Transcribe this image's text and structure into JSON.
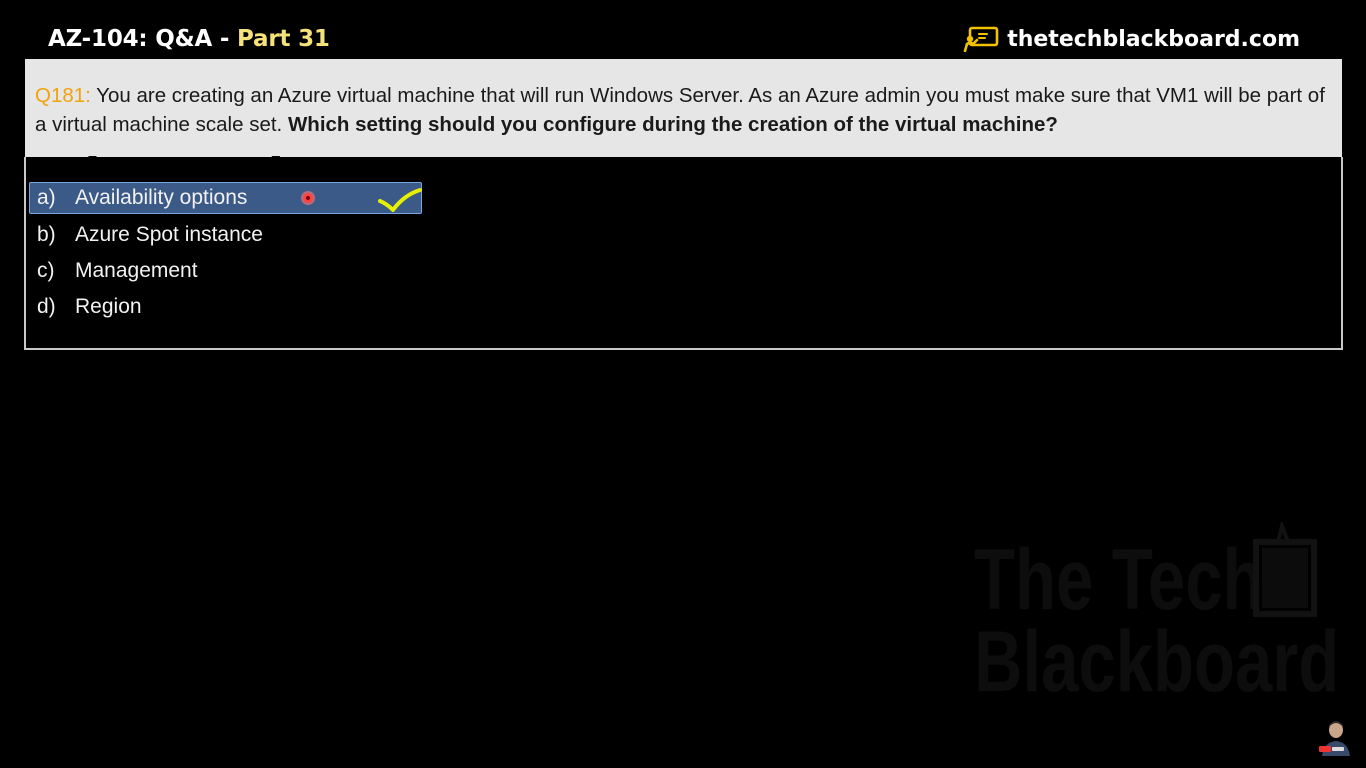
{
  "header": {
    "title_main": "AZ-104: Q&A",
    "title_sep": " - ",
    "title_part": "Part 31",
    "brand_text": "thetechblackboard.com",
    "brand_icon": "presentation-board-icon"
  },
  "question": {
    "number": "Q181:",
    "text": " You are creating an Azure virtual machine that will run Windows Server. As an Azure admin you must make sure that VM1 will be part of a virtual machine scale set. ",
    "bold_text": "Which setting should you configure during the creation of the virtual machine?"
  },
  "options": [
    {
      "letter": "a)",
      "label": "Availability options",
      "selected": true
    },
    {
      "letter": "b)",
      "label": "Azure Spot instance",
      "selected": false
    },
    {
      "letter": "c)",
      "label": "Management",
      "selected": false
    },
    {
      "letter": "d)",
      "label": "Region",
      "selected": false
    }
  ],
  "watermark": {
    "line1": "The Tech",
    "line2": "Blackboard"
  },
  "colors": {
    "background": "#000000",
    "panel": "#e6e6e6",
    "question_number": "#f0a30a",
    "part_accent": "#f6e27a",
    "selected_option": "#3c5a88",
    "checkmark": "#e8f000"
  }
}
